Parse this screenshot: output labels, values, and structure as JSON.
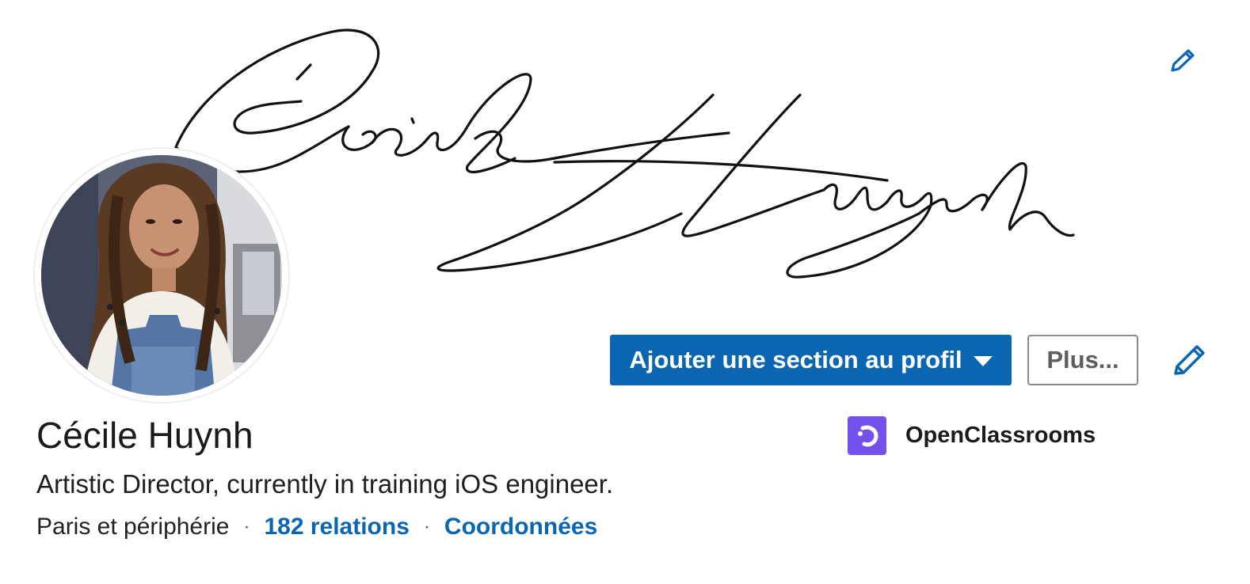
{
  "banner": {
    "signature_text": "Cécile Huynh",
    "edit_icon": "pencil-icon"
  },
  "profile": {
    "name": "Cécile Huynh",
    "headline": "Artistic Director, currently in training iOS engineer.",
    "location": "Paris et périphérie",
    "separator": "·",
    "connections": "182 relations",
    "contact_info": "Coordonnées"
  },
  "actions": {
    "add_section_label": "Ajouter une section au profil",
    "more_label": "Plus...",
    "edit_icon": "pencil-icon"
  },
  "company": {
    "name": "OpenClassrooms",
    "logo_icon": "openclassrooms-logo"
  },
  "colors": {
    "primary_blue": "#0a66b0",
    "company_purple": "#7451eb",
    "text": "#1a1a1a"
  }
}
